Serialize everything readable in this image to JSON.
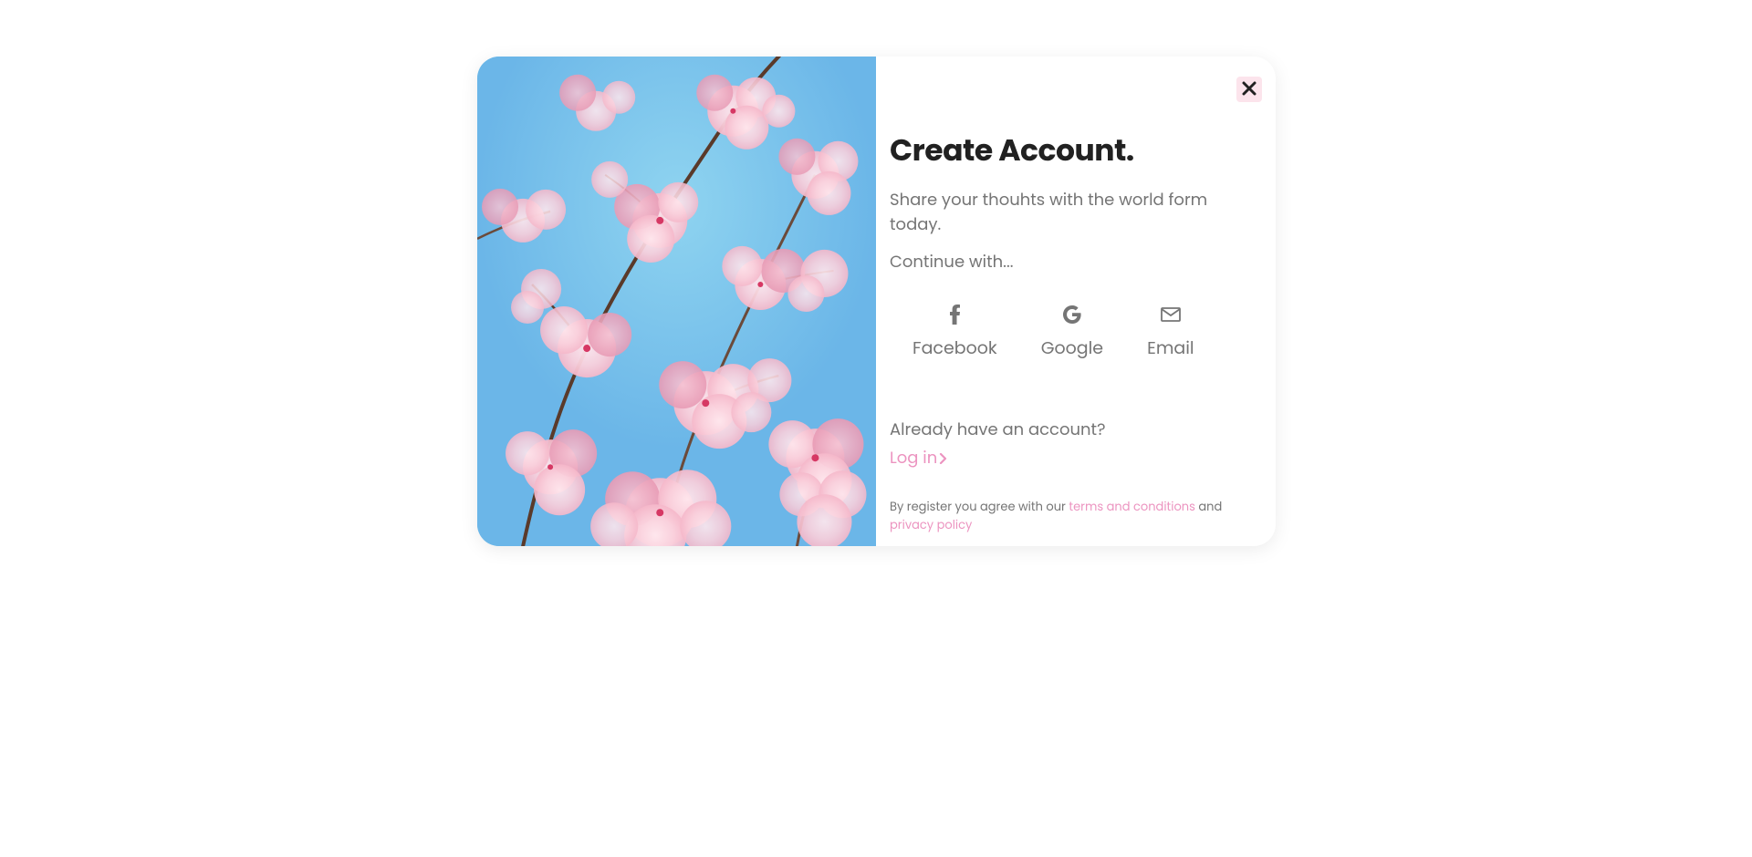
{
  "title": "Create Account.",
  "subtitle": "Share your thouhts with the world form today.",
  "continueLabel": "Continue with...",
  "socialButtons": {
    "facebook": "Facebook",
    "google": "Google",
    "email": "Email"
  },
  "alreadyAccount": "Already have an account?",
  "loginLink": "Log in",
  "terms": {
    "prefix": "By register you agree with our ",
    "termsLink": "terms and conditions",
    "connector": "  and  ",
    "privacyLink": "privacy policy"
  }
}
